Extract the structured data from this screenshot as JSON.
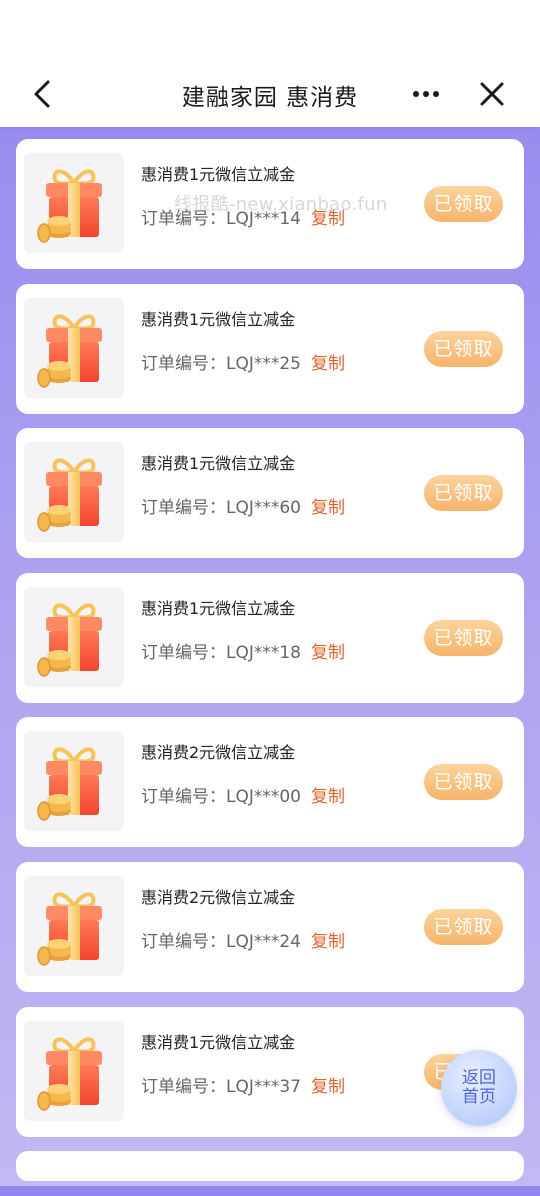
{
  "header": {
    "title": "建融家园 惠消费"
  },
  "watermark": "线报酷-new.xianbao.fun",
  "orders": [
    {
      "name": "惠消费1元微信立减金",
      "order_label": "订单编号：",
      "order_no": "LQJ***14",
      "copy": "复制",
      "status": "已领取"
    },
    {
      "name": "惠消费1元微信立减金",
      "order_label": "订单编号：",
      "order_no": "LQJ***25",
      "copy": "复制",
      "status": "已领取"
    },
    {
      "name": "惠消费1元微信立减金",
      "order_label": "订单编号：",
      "order_no": "LQJ***60",
      "copy": "复制",
      "status": "已领取"
    },
    {
      "name": "惠消费1元微信立减金",
      "order_label": "订单编号：",
      "order_no": "LQJ***18",
      "copy": "复制",
      "status": "已领取"
    },
    {
      "name": "惠消费2元微信立减金",
      "order_label": "订单编号：",
      "order_no": "LQJ***00",
      "copy": "复制",
      "status": "已领取"
    },
    {
      "name": "惠消费2元微信立减金",
      "order_label": "订单编号：",
      "order_no": "LQJ***24",
      "copy": "复制",
      "status": "已领取"
    },
    {
      "name": "惠消费1元微信立减金",
      "order_label": "订单编号：",
      "order_no": "LQJ***37",
      "copy": "复制",
      "status": "已领取"
    }
  ],
  "home_button": {
    "line1": "返回",
    "line2": "首页"
  },
  "colors": {
    "accent_orange": "#e0642e",
    "claim_button": "#f6b56b",
    "background_top": "#8f86ee",
    "background_bottom": "#c2b8f2",
    "home_button_text": "#4a64d8"
  },
  "icons": {
    "back": "chevron-left-icon",
    "more": "more-dots-icon",
    "close": "close-icon",
    "item": "gift-box-icon"
  }
}
